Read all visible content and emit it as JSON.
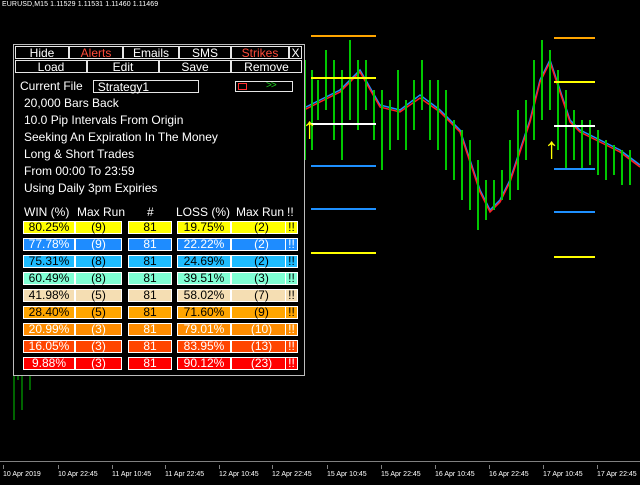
{
  "chart_header": "EURUSD,M15  1.11529 1.11531 1.11460 1.11469",
  "timeline": [
    "10 Apr 2019",
    "10 Apr 22:45",
    "11 Apr 10:45",
    "11 Apr 22:45",
    "12 Apr 10:45",
    "12 Apr 22:45",
    "15 Apr 10:45",
    "15 Apr 22:45",
    "16 Apr 10:45",
    "16 Apr 22:45",
    "17 Apr 10:45",
    "17 Apr 22:45"
  ],
  "panel": {
    "tabs": {
      "hide": "Hide",
      "alerts": "Alerts",
      "emails": "Emails",
      "sms": "SMS",
      "strikes": "Strikes",
      "close": "X"
    },
    "actions": {
      "load": "Load",
      "edit": "Edit",
      "save": "Save",
      "remove": "Remove"
    },
    "current_file_label": "Current File",
    "current_file_value": "Strategy1",
    "play_arrows": ">>",
    "info": [
      "20,000 Bars Back",
      "10.0 Pip Intervals From Origin",
      "Seeking An Expiration In The Money",
      "Long & Short Trades",
      "From 00:00 To 23:59",
      "Using Daily 3pm Expiries"
    ],
    "table_headers": {
      "win": "WIN (%)",
      "maxrun1": "Max Run",
      "count": "#",
      "loss": "LOSS (%)",
      "maxrun2": "Max Run",
      "bang": "!!"
    },
    "rows": [
      {
        "win": "80.25%",
        "run1": "(9)",
        "count": "81",
        "loss": "19.75%",
        "run2": "(2)",
        "bang": "!!",
        "color": "#ffff00"
      },
      {
        "win": "77.78%",
        "run1": "(9)",
        "count": "81",
        "loss": "22.22%",
        "run2": "(2)",
        "bang": "!!",
        "color": "#1e8cff"
      },
      {
        "win": "75.31%",
        "run1": "(8)",
        "count": "81",
        "loss": "24.69%",
        "run2": "(2)",
        "bang": "!!",
        "color": "#1ebcff"
      },
      {
        "win": "60.49%",
        "run1": "(8)",
        "count": "81",
        "loss": "39.51%",
        "run2": "(3)",
        "bang": "!!",
        "color": "#7fffd4"
      },
      {
        "win": "41.98%",
        "run1": "(5)",
        "count": "81",
        "loss": "58.02%",
        "run2": "(7)",
        "bang": "!!",
        "color": "#f5deb3"
      },
      {
        "win": "28.40%",
        "run1": "(5)",
        "count": "81",
        "loss": "71.60%",
        "run2": "(9)",
        "bang": "!!",
        "color": "#ffa500"
      },
      {
        "win": "20.99%",
        "run1": "(3)",
        "count": "81",
        "loss": "79.01%",
        "run2": "(10)",
        "bang": "!!",
        "color": "#ff8c00"
      },
      {
        "win": "16.05%",
        "run1": "(3)",
        "count": "81",
        "loss": "83.95%",
        "run2": "(13)",
        "bang": "!!",
        "color": "#ff4500"
      },
      {
        "win": "9.88%",
        "run1": "(3)",
        "count": "81",
        "loss": "90.12%",
        "run2": "(23)",
        "bang": "!!",
        "color": "#ff0000"
      }
    ]
  },
  "colors": {
    "arrow": "#ffff00",
    "orange_line": "#ffa500",
    "yellow_line": "#ffff00",
    "white_line": "#ffffff",
    "blue_line": "#1e90ff",
    "chart_candle_green": "#00c800",
    "chart_ma_red": "#ff2020",
    "chart_ma_blue": "#1e90ff"
  }
}
